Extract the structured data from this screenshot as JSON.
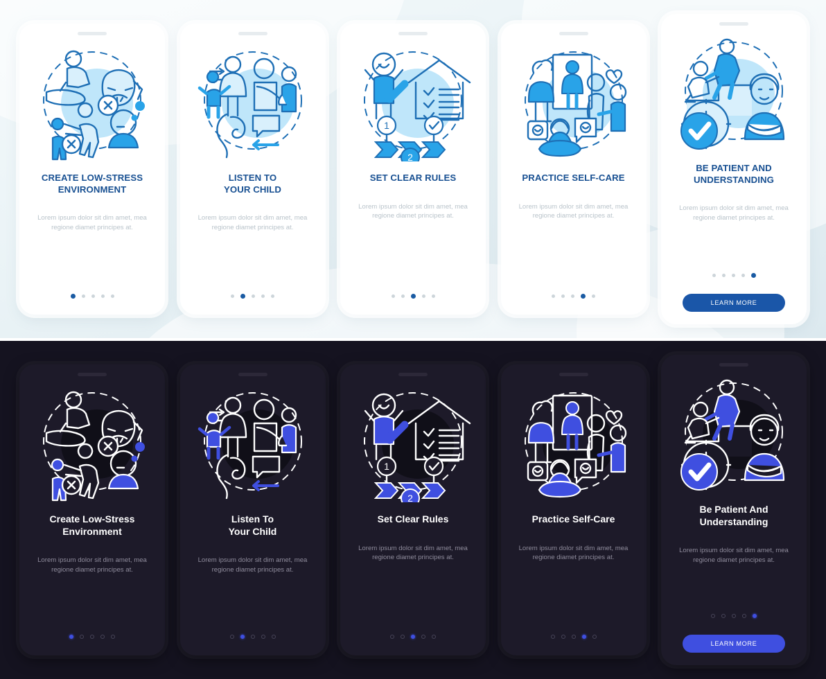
{
  "meta": {
    "kind": "onboarding-screens-mockup",
    "variants": [
      "light",
      "dark"
    ],
    "colors": {
      "light_bg": "#eaf3f6",
      "light_card": "#ffffff",
      "light_title": "#185092",
      "light_body": "#b9c3ca",
      "light_accent": "#1a56a8",
      "light_dot_inactive": "#cdd5da",
      "dark_bg": "#151320",
      "dark_card": "#1d1a29",
      "dark_title": "#ffffff",
      "dark_body": "#8f8c9c",
      "dark_accent": "#3f4fe0",
      "illus_blue": "#29a3e8",
      "illus_stroke": "#1e6fb5",
      "illus_blob": "#bfe6fa"
    }
  },
  "body_text": "Lorem ipsum dolor sit dim amet, mea regione diamet principes at.",
  "cta_label": "LEARN MORE",
  "light_screens": [
    {
      "title": "CREATE LOW-STRESS ENVIRONMENT",
      "title_l1": "CREATE LOW-STRESS",
      "title_l2": "ENVIRONMENT",
      "body": "Lorem ipsum dolor sit dim amet, mea regione diamet principes at.",
      "icon": "stress-free-family-icon",
      "active_dot": 1,
      "dots": 5,
      "has_cta": false
    },
    {
      "title": "LISTEN TO YOUR CHILD",
      "title_l1": "LISTEN TO",
      "title_l2": "YOUR CHILD",
      "body": "Lorem ipsum dolor sit dim amet, mea regione diamet principes at.",
      "icon": "listening-ear-icon",
      "active_dot": 2,
      "dots": 5,
      "has_cta": false
    },
    {
      "title": "SET CLEAR RULES",
      "title_l1": "SET CLEAR RULES",
      "title_l2": "",
      "body": "Lorem ipsum dolor sit dim amet, mea regione diamet principes at.",
      "icon": "house-checklist-icon",
      "active_dot": 3,
      "dots": 5,
      "has_cta": false
    },
    {
      "title": "PRACTICE SELF-CARE",
      "title_l1": "PRACTICE SELF-CARE",
      "title_l2": "",
      "body": "Lorem ipsum dolor sit dim amet, mea regione diamet principes at.",
      "icon": "self-care-meditation-icon",
      "active_dot": 4,
      "dots": 5,
      "has_cta": false
    },
    {
      "title": "BE PATIENT AND UNDERSTANDING",
      "title_l1": "BE PATIENT AND",
      "title_l2": "UNDERSTANDING",
      "body": "Lorem ipsum dolor sit dim amet, mea regione diamet principes at.",
      "icon": "patience-support-icon",
      "active_dot": 5,
      "dots": 5,
      "has_cta": true,
      "cta_label": "LEARN MORE"
    }
  ],
  "dark_screens": [
    {
      "title": "Create Low-Stress Environment",
      "title_l1": "Create Low-Stress",
      "title_l2": "Environment",
      "body": "Lorem ipsum dolor sit dim amet, mea regione diamet principes at.",
      "icon": "stress-free-family-icon",
      "active_dot": 1,
      "dots": 5,
      "has_cta": false
    },
    {
      "title": "Listen To Your Child",
      "title_l1": "Listen To",
      "title_l2": "Your Child",
      "body": "Lorem ipsum dolor sit dim amet, mea regione diamet principes at.",
      "icon": "listening-ear-icon",
      "active_dot": 2,
      "dots": 5,
      "has_cta": false
    },
    {
      "title": "Set Clear Rules",
      "title_l1": "Set Clear Rules",
      "title_l2": "",
      "body": "Lorem ipsum dolor sit dim amet, mea regione diamet principes at.",
      "icon": "house-checklist-icon",
      "active_dot": 3,
      "dots": 5,
      "has_cta": false
    },
    {
      "title": "Practice Self-Care",
      "title_l1": "Practice Self-Care",
      "title_l2": "",
      "body": "Lorem ipsum dolor sit dim amet, mea regione diamet principes at.",
      "icon": "self-care-meditation-icon",
      "active_dot": 4,
      "dots": 5,
      "has_cta": false
    },
    {
      "title": "Be Patient And Understanding",
      "title_l1": "Be Patient And",
      "title_l2": "Understanding",
      "body": "Lorem ipsum dolor sit dim amet, mea regione diamet principes at.",
      "icon": "patience-support-icon",
      "active_dot": 5,
      "dots": 5,
      "has_cta": true,
      "cta_label": "LEARN MORE"
    }
  ]
}
